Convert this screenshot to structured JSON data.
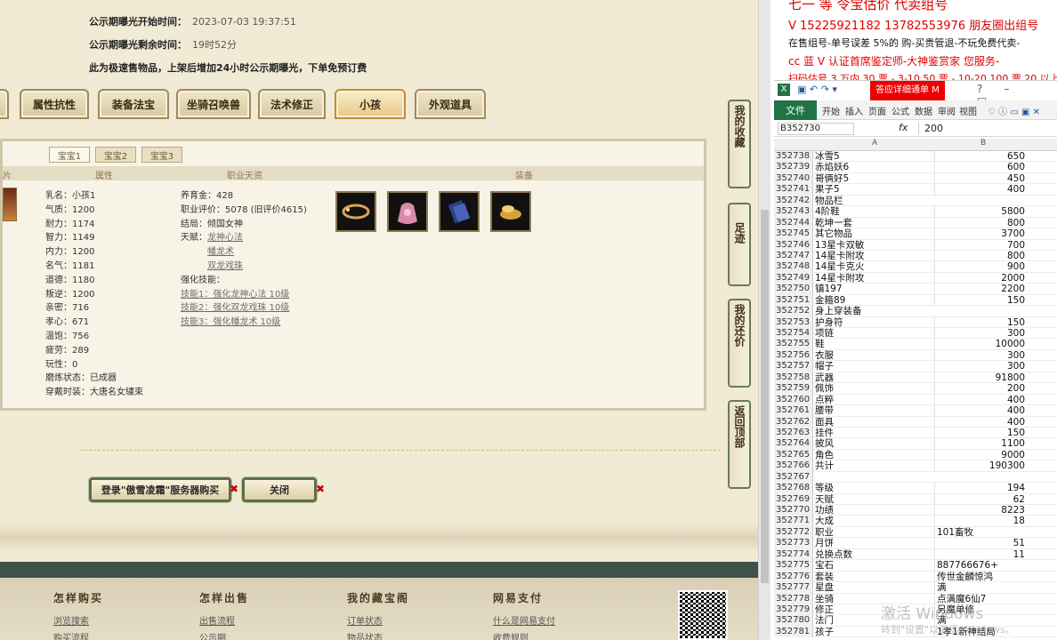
{
  "listing": {
    "start_label": "公示期曝光开始时间：",
    "start_value": "2023-07-03 19:37:51",
    "remain_label": "公示期曝光剩余时间：",
    "remain_value": "19时52分",
    "notice": "此为极速售物品，上架后增加24小时公示期曝光，下单免预订费"
  },
  "tabs": [
    "属性抗性",
    "装备法宝",
    "坐骑召唤兽",
    "法术修正",
    "小孩",
    "外观道具"
  ],
  "child_tabs": [
    "宝宝1",
    "宝宝2",
    "宝宝3"
  ],
  "table_headers": [
    "片",
    "属性",
    "职业天资",
    "装备"
  ],
  "child_attrs": [
    "乳名：小孩1",
    "气质：1200",
    "耐力：1174",
    "智力：1149",
    "内力：1200",
    "名气：1181",
    "道德：1180",
    "叛逆：1200",
    "亲密：716",
    "孝心：671",
    "温饱：756",
    "疲劳：289",
    "玩性：0",
    "磨炼状态：已成器",
    "穿戴时装：大唐名女繍束"
  ],
  "career": {
    "money": "养育金：428",
    "score": "职业评价：5078 (旧评价4615)",
    "ending": "结局：倾国女神",
    "talent_label": "天赋：",
    "talents": [
      "龙神心法",
      "幡龙术",
      "双龙戏珠"
    ],
    "skill_label": "强化技能：",
    "skills": [
      "技能1：强化龙神心法 10级",
      "技能2：强化双龙戏珠 10级",
      "技能3：强化幡龙术 10级"
    ]
  },
  "buttons": {
    "login_buy": "登录\"傲雪凌霜\"服务器购买",
    "close": "关闭"
  },
  "side_buttons": [
    "我的收藏",
    "足迹",
    "我的还价",
    "返回顶部"
  ],
  "footer": {
    "cols": [
      "怎样购买",
      "怎样出售",
      "我的藏宝阁",
      "网易支付"
    ],
    "links": [
      "浏览搜索",
      "购买流程",
      "出售流程",
      "公示期",
      "订单状态",
      "物品状态",
      "什么是网易支付",
      "收费规则"
    ]
  },
  "right_text": {
    "line1": "V 15225921182  13782553976 朋友圈出组号",
    "line2": "在售组号-单号误差 5%的    购-买贵管退-不玩免费代卖-",
    "line3": "cc 蓝 V 认证首席鉴定师-大神鉴赏家 您服务-",
    "line4": "扫码估号 3 万内 30 票 - 3-10 50 票 - 10-20 100 票  20 以上 15"
  },
  "excel": {
    "file_tab": "文件",
    "ribbon": [
      "开始",
      "插入",
      "页面",
      "公式",
      "数据",
      "审阅",
      "视图"
    ],
    "title_badge": "答应详细通单 M",
    "name_box": "B352730",
    "fx": "fx",
    "formula_value": "200",
    "col_a": "A",
    "col_b": "B",
    "rows": [
      [
        "352738",
        "冰雪5",
        "650"
      ],
      [
        "352739",
        "赤焰妖6",
        "600"
      ],
      [
        "352740",
        "哥俩好5",
        "450"
      ],
      [
        "352741",
        "果子5",
        "400"
      ],
      [
        "352742",
        "物品栏",
        ""
      ],
      [
        "352743",
        "4阶鞋",
        "5800"
      ],
      [
        "352744",
        "乾坤一套",
        "800"
      ],
      [
        "352745",
        "其它物品",
        "3700"
      ],
      [
        "352746",
        "13星卡双敏",
        "700"
      ],
      [
        "352747",
        "14星卡附攻",
        "800"
      ],
      [
        "352748",
        "14星卡克火",
        "900"
      ],
      [
        "352749",
        "14星卡附攻",
        "2000"
      ],
      [
        "352750",
        "镇197",
        "2200"
      ],
      [
        "352751",
        "金箍89",
        "150"
      ],
      [
        "352752",
        "身上穿装备",
        ""
      ],
      [
        "352753",
        "护身符",
        "150"
      ],
      [
        "352754",
        "项链",
        "300"
      ],
      [
        "352755",
        "鞋",
        "10000"
      ],
      [
        "352756",
        "衣服",
        "300"
      ],
      [
        "352757",
        "帽子",
        "300"
      ],
      [
        "352758",
        "武器",
        "91800"
      ],
      [
        "352759",
        "佩饰",
        "200"
      ],
      [
        "352760",
        "点粹",
        "400"
      ],
      [
        "352761",
        "腰带",
        "400"
      ],
      [
        "352762",
        "面具",
        "400"
      ],
      [
        "352763",
        "挂件",
        "150"
      ],
      [
        "352764",
        "披风",
        "1100"
      ],
      [
        "352765",
        "角色",
        "9000"
      ],
      [
        "352766",
        "共计",
        "190300"
      ],
      [
        "352767",
        "",
        ""
      ],
      [
        "352768",
        "等级",
        "194"
      ],
      [
        "352769",
        "天赋",
        "62"
      ],
      [
        "352770",
        "功绩",
        "8223"
      ],
      [
        "352771",
        "大成",
        "18"
      ],
      [
        "352772",
        "职业",
        "101畜牧"
      ],
      [
        "352773",
        "月饼",
        "51"
      ],
      [
        "352774",
        "兑换点数",
        "11"
      ],
      [
        "352775",
        "宝石",
        "887766676+"
      ],
      [
        "352776",
        "套装",
        "传世金麟惊鸿"
      ],
      [
        "352777",
        "星盘",
        "满"
      ],
      [
        "352778",
        "坐骑",
        "点满魔6仙7"
      ],
      [
        "352779",
        "修正",
        "另魔单修"
      ],
      [
        "352780",
        "法门",
        "满"
      ],
      [
        "352781",
        "孩子",
        "1孝1新神结局"
      ]
    ],
    "watermark1": "激活 Windows",
    "watermark2": "转到\"设置\"以激活 Windows。"
  }
}
